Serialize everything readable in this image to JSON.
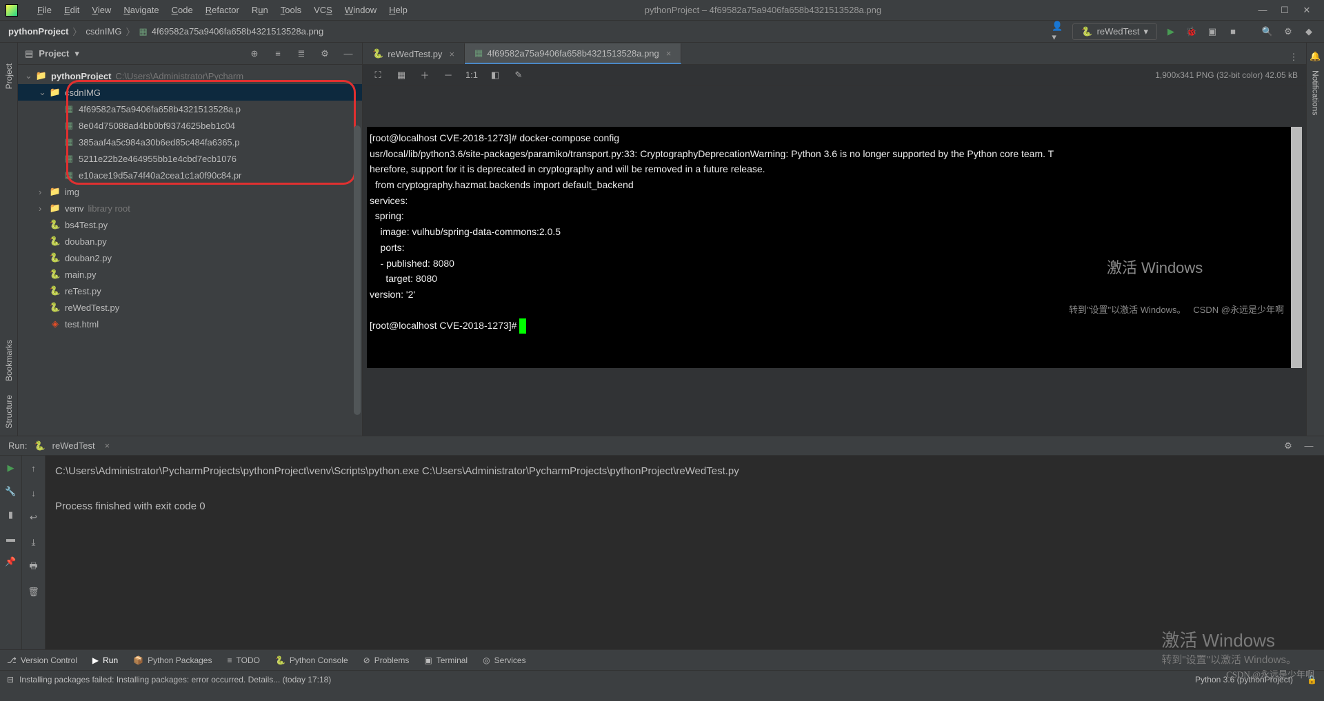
{
  "title": "pythonProject – 4f69582a75a9406fa658b4321513528a.png",
  "menu": [
    "File",
    "Edit",
    "View",
    "Navigate",
    "Code",
    "Refactor",
    "Run",
    "Tools",
    "VCS",
    "Window",
    "Help"
  ],
  "breadcrumb": {
    "root": "pythonProject",
    "folder": "csdnIMG",
    "file": "4f69582a75a9406fa658b4321513528a.png"
  },
  "run_config": "reWedTest",
  "project_panel": {
    "title": "Project",
    "root_name": "pythonProject",
    "root_path": "C:\\Users\\Administrator\\Pycharm",
    "folders_circled": "csdnIMG",
    "png_files": [
      "4f69582a75a9406fa658b4321513528a.p",
      "8e04d75088ad4bb0bf9374625beb1c04",
      "385aaf4a5c984a30b6ed85c484fa6365.p",
      "5211e22b2e464955bb1e4cbd7ecb1076",
      "e10ace19d5a74f40a2cea1c1a0f90c84.pr"
    ],
    "folder_img": "img",
    "folder_venv": "venv",
    "venv_hint": "library root",
    "py_files": [
      "bs4Test.py",
      "douban.py",
      "douban2.py",
      "main.py",
      "reTest.py",
      "reWedTest.py"
    ],
    "html_file": "test.html"
  },
  "editor": {
    "tabs": [
      {
        "label": "reWedTest.py",
        "type": "py",
        "active": false
      },
      {
        "label": "4f69582a75a9406fa658b4321513528a.png",
        "type": "png",
        "active": true
      }
    ],
    "image_info": "1,900x341 PNG (32-bit color) 42.05 kB",
    "terminal_lines": [
      "[root@localhost CVE-2018-1273]# docker-compose config",
      "usr/local/lib/python3.6/site-packages/paramiko/transport.py:33: CryptographyDeprecationWarning: Python 3.6 is no longer supported by the Python core team. T",
      "herefore, support for it is deprecated in cryptography and will be removed in a future release.",
      "  from cryptography.hazmat.backends import default_backend",
      "services:",
      "  spring:",
      "    image: vulhub/spring-data-commons:2.0.5",
      "    ports:",
      "    - published: 8080",
      "      target: 8080",
      "version: '2'",
      "",
      "[root@localhost CVE-2018-1273]# "
    ],
    "watermark_title": "激活 Windows",
    "watermark_sub": "转到\"设置\"以激活 Windows。   CSDN @永远是少年啊"
  },
  "run_panel": {
    "label": "Run:",
    "name": "reWedTest",
    "console_line1": "C:\\Users\\Administrator\\PycharmProjects\\pythonProject\\venv\\Scripts\\python.exe C:\\Users\\Administrator\\PycharmProjects\\pythonProject\\reWedTest.py",
    "console_line2": "Process finished with exit code 0"
  },
  "bottom_tabs": [
    "Version Control",
    "Run",
    "Python Packages",
    "TODO",
    "Python Console",
    "Problems",
    "Terminal",
    "Services"
  ],
  "status": {
    "msg": "Installing packages failed: Installing packages: error occurred. Details... (today 17:18)",
    "interpreter": "Python 3.6 (pythonProject)"
  },
  "sidebar_left": [
    "Project",
    "Bookmarks",
    "Structure"
  ],
  "sidebar_right": "Notifications",
  "activate_big": "激活 Windows",
  "activate_small": "转到\"设置\"以激活 Windows。",
  "csdn_watermark": "CSDN @永远是少年啊"
}
